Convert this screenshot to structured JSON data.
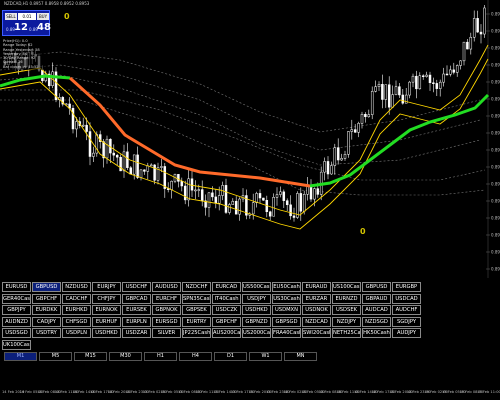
{
  "window": {
    "title": "NZDCAD,H1 0.8957 0.8958 0.8952 0.8953"
  },
  "trade_panel": {
    "sell_label": "SELL",
    "buy_label": "BUY",
    "lot": "0.01",
    "bid_prefix": "0.89",
    "bid_big": "12",
    "ask_prefix": "0.89",
    "ask_big": "48"
  },
  "info_lines": [
    "Price(H1): 0.0",
    "Range Today: 62",
    "Range Yesterday: 58",
    "Yesterday: 84",
    "30 Day Range: 92",
    "Spread: 36",
    "Bar closes in: 15:52",
    "0.8969"
  ],
  "markers": [
    {
      "label": "0"
    },
    {
      "label": "0"
    }
  ],
  "price_axis": {
    "labels": [
      "0.8974",
      "0.8970",
      "0.8966",
      "0.8962",
      "0.8958",
      "0.8954",
      "0.8950",
      "0.8946",
      "0.8942",
      "0.8938",
      "0.8934",
      "0.8930",
      "0.8926",
      "0.8922",
      "0.8918",
      "0.8914"
    ]
  },
  "symbols": {
    "rows": [
      [
        "EURUSD",
        "GBPUSD",
        "NZDUSD",
        "EURJPY",
        "USDCHF",
        "AUDUSD",
        "NZDCHF",
        "EURCAD",
        "US500Cash",
        "EU50Cash",
        "EURAUD",
        "US100Cash",
        "GBPUSD",
        "EURGBP"
      ],
      [
        "GER40Cash",
        "GBPCHF",
        "CADCHF",
        "CHFJPY",
        "GBPCAD",
        "EURCHF",
        "SPN35Cash",
        "IT40Cash",
        "USDJPY",
        "US30Cash",
        "EURZAR",
        "EURNZD",
        "GBPAUD",
        "USDCAD"
      ],
      [
        "GBPJPY",
        "EURDKK",
        "EURHKD",
        "EURNOK",
        "EURSEK",
        "GBPNOK",
        "GBPSEK",
        "USDCZK",
        "USDHKD",
        "USDMXN",
        "USDNOK",
        "USDSEK",
        "AUDCAD",
        "AUDCHF"
      ],
      [
        "AUDNZD",
        "CADJPY",
        "CHFSGD",
        "EURHUF",
        "EURPLN",
        "EURSGD",
        "EURTRY",
        "GBPCHF",
        "GBPNZD",
        "GBPSGD",
        "NZDCAD",
        "NZDJPY",
        "NZDSGD",
        "SGDJPY"
      ],
      [
        "USDSGD",
        "USDTRY",
        "USDPLN",
        "USDHKD",
        "USDZAR",
        "SILVER",
        "JP225Cash",
        "AUS200Cash",
        "US2000Cash",
        "FRA40Cash",
        "SWI20Cash",
        "NETH25Cash",
        "HK50Cash",
        "AUDJPY"
      ],
      [
        "UK100Cash"
      ]
    ],
    "active": "GBPUSD"
  },
  "timeframes": {
    "items": [
      "M1",
      "M5",
      "M15",
      "M30",
      "H1",
      "H4",
      "D1",
      "W1",
      "MN"
    ],
    "active": "M1"
  },
  "time_axis": {
    "labels": [
      "14 Feb 2019",
      "14 Feb 05:00",
      "14 Feb 08:00",
      "14 Feb 11:00",
      "14 Feb 14:00",
      "14 Feb 17:00",
      "14 Feb 20:00",
      "14 Feb 23:00",
      "15 Feb 02:00",
      "15 Feb 05:00",
      "15 Feb 08:00",
      "15 Feb 11:00",
      "15 Feb 14:00",
      "15 Feb 17:00",
      "15 Feb 20:00",
      "15 Feb 23:00",
      "18 Feb 02:00",
      "18 Feb 05:00",
      "18 Feb 08:00",
      "18 Feb 11:00",
      "18 Feb 14:00",
      "18 Feb 17:00",
      "18 Feb 20:00",
      "18 Feb 23:00",
      "19 Feb 02:00",
      "19 Feb 05:00",
      "19 Feb 08:00",
      "19 Feb 11:00"
    ]
  },
  "colors": {
    "background": "#000000",
    "candle": "#ffffff",
    "ma_fast": "#ffd700",
    "ma_slow_up": "#22dd22",
    "ma_slow_down": "#ff6a2a",
    "envelope": "#7a7a7a",
    "panel_blue": "#0b1a9e"
  }
}
